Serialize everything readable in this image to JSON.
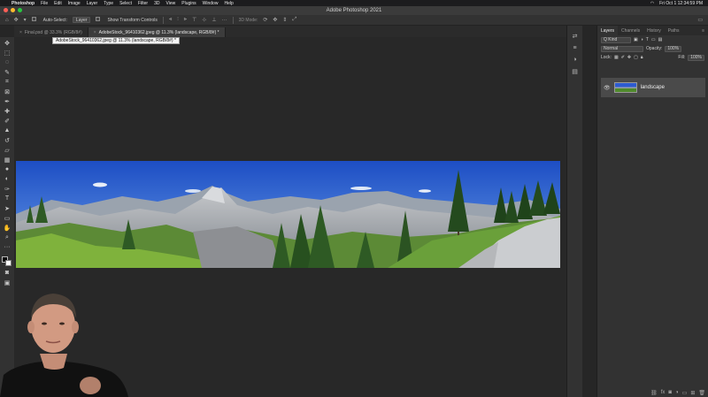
{
  "menubar": {
    "app_name": "Photoshop",
    "items": [
      "File",
      "Edit",
      "Image",
      "Layer",
      "Type",
      "Select",
      "Filter",
      "3D",
      "View",
      "Plugins",
      "Window",
      "Help"
    ],
    "clock": "Fri Oct 1  12:34:59 PM"
  },
  "window": {
    "title": "Adobe Photoshop 2021"
  },
  "options": {
    "auto_select_label": "Auto-Select:",
    "auto_select_value": "Layer",
    "transform_controls_label": "Show Transform Controls",
    "mode_3d_label": "3D Mode:"
  },
  "document_tabs": [
    {
      "label": "Final.psd @ 33.3% (RGB/8#)",
      "active": false
    },
    {
      "label": "AdobeStock_96410362.jpeg @ 11.3% (landscape, RGB/8#) *",
      "active": true
    }
  ],
  "tooltip": {
    "text": "AdobeStock_96410362.jpeg @ 11.3% (landscape, RGB/8#) *"
  },
  "layers_panel": {
    "tabs": [
      "Layers",
      "Channels",
      "History",
      "Paths"
    ],
    "active_tab": "Layers",
    "kind_label": "Q Kind",
    "blend_mode": "Normal",
    "opacity_label": "Opacity:",
    "opacity_value": "100%",
    "lock_label": "Lock:",
    "fill_label": "Fill:",
    "fill_value": "100%",
    "layers": [
      {
        "name": "landscape",
        "visible": true
      }
    ]
  },
  "colors": {
    "menubar": "#1c1c1e",
    "titlebar": "#3b3b3b",
    "panel": "#323232",
    "canvas": "#282828",
    "sky": "#2f63d8",
    "grass": "#6da23a",
    "traffic_close": "#ff5f57",
    "traffic_min": "#febc2e",
    "traffic_max": "#28c840"
  }
}
